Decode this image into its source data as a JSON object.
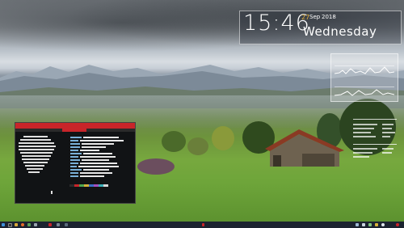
{
  "clock": {
    "time": "15:46",
    "day_number": "27",
    "month": "Sep",
    "year": "2018",
    "weekday": "Wednesday"
  },
  "terminal": {
    "title": "",
    "tab": "",
    "prompt": ""
  },
  "taskbar": {
    "launcher_icons": [
      "menu-icon",
      "terminal-icon",
      "files-icon",
      "browser-icon",
      "editor-icon",
      "settings-icon"
    ],
    "tray_icons": [
      "network-icon",
      "volume-icon",
      "battery-icon",
      "notification-icon"
    ]
  },
  "colors": {
    "clock_accent": "#e8b23a",
    "terminal_titlebar": "#c8252a",
    "taskbar_bg": "#1c2330"
  }
}
